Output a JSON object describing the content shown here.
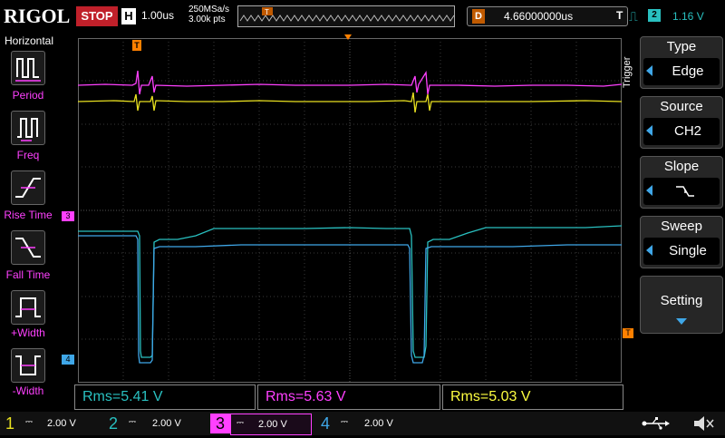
{
  "top": {
    "logo": "RIGOL",
    "run_state": "STOP",
    "timebase_label": "H",
    "timebase": "1.00us",
    "sample_rate": "250MSa/s",
    "memory_points": "3.00k pts",
    "delay_label": "D",
    "delay": "4.66000000us",
    "trigger_label": "T",
    "trigger_source_num": "2",
    "trigger_level": "1.16 V"
  },
  "left_panel": {
    "title": "Horizontal",
    "items": [
      {
        "label": "Period",
        "icon": "period-icon"
      },
      {
        "label": "Freq",
        "icon": "freq-icon"
      },
      {
        "label": "Rise Time",
        "icon": "rise-time-icon"
      },
      {
        "label": "Fall Time",
        "icon": "fall-time-icon"
      },
      {
        "label": "+Width",
        "icon": "positive-width-icon"
      },
      {
        "label": "-Width",
        "icon": "negative-width-icon"
      }
    ]
  },
  "right_panel": {
    "side_label": "Trigger",
    "type": {
      "title": "Type",
      "value": "Edge"
    },
    "source": {
      "title": "Source",
      "value": "CH2"
    },
    "slope": {
      "title": "Slope",
      "icon": "falling-edge-icon"
    },
    "sweep": {
      "title": "Sweep",
      "value": "Single"
    },
    "setting": {
      "title": "Setting"
    }
  },
  "measurements": [
    {
      "text": "Rms=5.41 V",
      "color": "#29c0c0"
    },
    {
      "text": "Rms=5.63 V",
      "color": "#ff40ff"
    },
    {
      "text": "Rms=5.03 V",
      "color": "#ffff40"
    }
  ],
  "channels": [
    {
      "num": "1",
      "scale": "2.00 V",
      "color": "#e8e020"
    },
    {
      "num": "2",
      "scale": "2.00 V",
      "color": "#29c0c0"
    },
    {
      "num": "3",
      "scale": "2.00 V",
      "color": "#ff40ff"
    },
    {
      "num": "4",
      "scale": "2.00 V",
      "color": "#3fa7e8"
    }
  ],
  "markers": {
    "ch3_marker": "3",
    "ch4_marker": "4",
    "trigger_marker": "T"
  },
  "colors": {
    "ch1": "#e8e020",
    "ch2": "#29c0c0",
    "ch3": "#ff40ff",
    "ch4": "#3fa7e8",
    "stop": "#c0202a",
    "trigger_pos": "#ff8000"
  }
}
